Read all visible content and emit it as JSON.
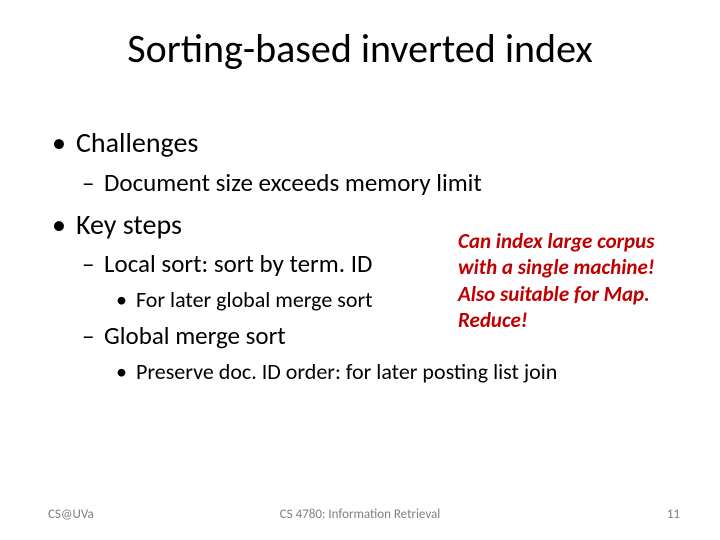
{
  "title": "Sorting-based inverted index",
  "bullets": {
    "challenges": {
      "label": "Challenges"
    },
    "doc_size": {
      "label": "Document size exceeds memory limit"
    },
    "key_steps": {
      "label": "Key steps"
    },
    "local_sort": {
      "label": "Local sort: sort by term. ID"
    },
    "later_merge": {
      "label": "For later global merge sort"
    },
    "global_merge": {
      "label": "Global merge sort"
    },
    "preserve": {
      "label": "Preserve doc. ID order: for later posting list join"
    }
  },
  "callout": "Can index large corpus with a single machine! Also suitable for Map. Reduce!",
  "footer": {
    "left": "CS@UVa",
    "center": "CS 4780: Information Retrieval",
    "right": "11"
  }
}
